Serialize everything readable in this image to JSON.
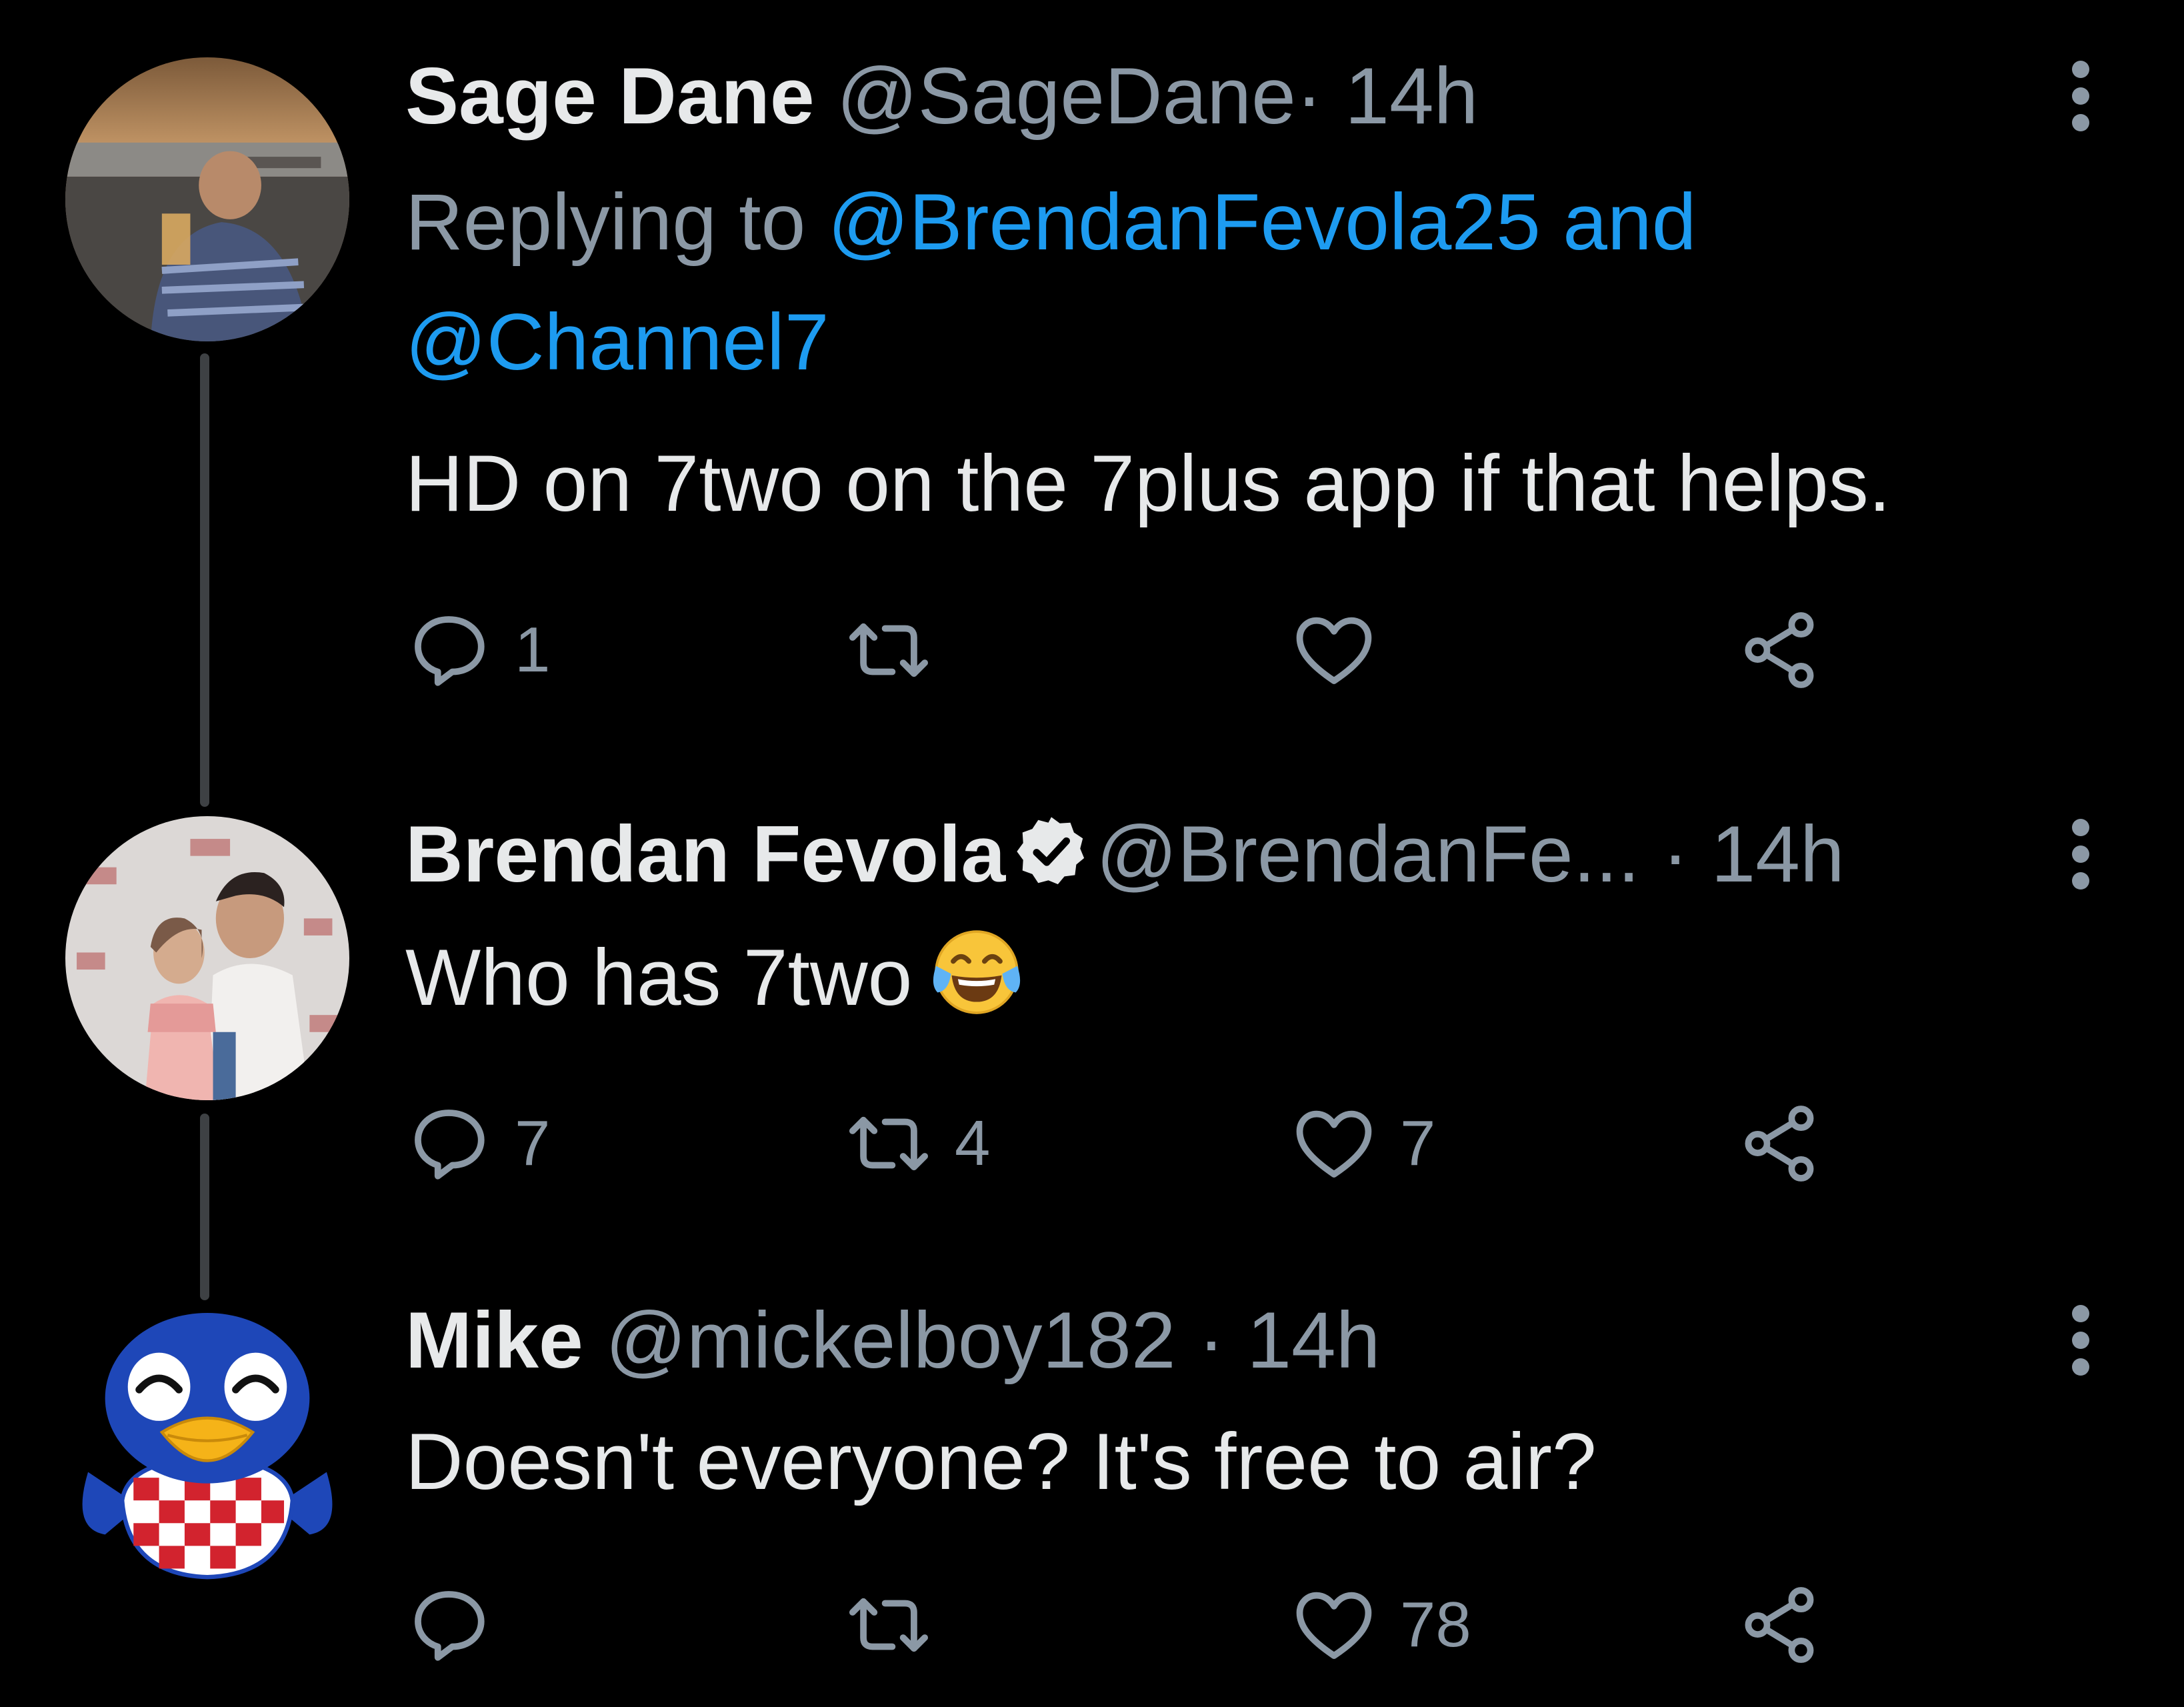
{
  "tweets": [
    {
      "name": "Sage Dane",
      "handle": "@SageDane",
      "separator": "·",
      "time": "14h",
      "replying_prefix": "Replying to",
      "replying_mention1": "@BrendanFevola25",
      "replying_and": "and",
      "replying_mention2": "@Channel7",
      "text": "HD on 7two on the 7plus app if that helps.",
      "counts": {
        "replies": "1",
        "retweets": "",
        "likes": ""
      }
    },
    {
      "name": "Brendan Fevola",
      "verified": true,
      "handle": "@BrendanFe...",
      "separator": "·",
      "time": "14h",
      "text": "Who has 7two",
      "emoji": "face-with-tears-of-joy",
      "counts": {
        "replies": "7",
        "retweets": "4",
        "likes": "7"
      }
    },
    {
      "name": "Mike",
      "handle": "@mickelboy182",
      "separator": "·",
      "time": "14h",
      "text": "Doesn't everyone? It's free to air?",
      "counts": {
        "replies": "",
        "retweets": "",
        "likes": "78"
      }
    }
  ],
  "colors": {
    "background": "#000000",
    "primary_text": "#e7e9ea",
    "secondary_text": "#8b98a5",
    "link": "#1d9bf0",
    "thread_line": "#3e4144"
  }
}
